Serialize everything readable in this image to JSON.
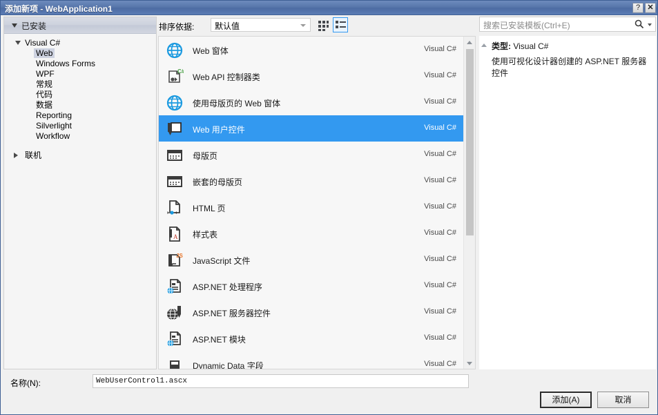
{
  "titlebar": {
    "title": "添加新项 - WebApplication1",
    "help_label": "?",
    "close_label": "✕"
  },
  "left_panel": {
    "installed_header": "已安装",
    "tree": [
      {
        "label": "Visual C#",
        "level": 1,
        "expanded": true,
        "selected": false
      },
      {
        "label": "Web",
        "level": 2,
        "expanded": false,
        "selected": true
      },
      {
        "label": "Windows Forms",
        "level": 2,
        "expanded": false,
        "selected": false
      },
      {
        "label": "WPF",
        "level": 2,
        "expanded": false,
        "selected": false
      },
      {
        "label": "常规",
        "level": 2,
        "expanded": false,
        "selected": false
      },
      {
        "label": "代码",
        "level": 2,
        "expanded": false,
        "selected": false
      },
      {
        "label": "数据",
        "level": 2,
        "expanded": false,
        "selected": false
      },
      {
        "label": "Reporting",
        "level": 2,
        "expanded": false,
        "selected": false
      },
      {
        "label": "Silverlight",
        "level": 2,
        "expanded": false,
        "selected": false
      },
      {
        "label": "Workflow",
        "level": 2,
        "expanded": false,
        "selected": false
      }
    ],
    "online_label": "联机"
  },
  "toolbar": {
    "sort_label": "排序依据:",
    "sort_value": "默认值",
    "view_tiles_name": "中等图标视图",
    "view_list_name": "详细信息视图"
  },
  "templates": [
    {
      "name": "Web 窗体",
      "lang": "Visual C#",
      "icon": "globe-icon",
      "selected": false
    },
    {
      "name": "Web API 控制器类",
      "lang": "Visual C#",
      "icon": "csharp-file-icon",
      "selected": false
    },
    {
      "name": "使用母版页的 Web 窗体",
      "lang": "Visual C#",
      "icon": "globe-icon",
      "selected": false
    },
    {
      "name": "Web 用户控件",
      "lang": "Visual C#",
      "icon": "user-control-icon",
      "selected": true
    },
    {
      "name": "母版页",
      "lang": "Visual C#",
      "icon": "master-page-icon",
      "selected": false
    },
    {
      "name": "嵌套的母版页",
      "lang": "Visual C#",
      "icon": "master-page-icon",
      "selected": false
    },
    {
      "name": "HTML 页",
      "lang": "Visual C#",
      "icon": "html-file-icon",
      "selected": false
    },
    {
      "name": "样式表",
      "lang": "Visual C#",
      "icon": "stylesheet-icon",
      "selected": false
    },
    {
      "name": "JavaScript 文件",
      "lang": "Visual C#",
      "icon": "javascript-file-icon",
      "selected": false
    },
    {
      "name": "ASP.NET 处理程序",
      "lang": "Visual C#",
      "icon": "aspnet-handler-icon",
      "selected": false
    },
    {
      "name": "ASP.NET 服务器控件",
      "lang": "Visual C#",
      "icon": "aspnet-server-control-icon",
      "selected": false
    },
    {
      "name": "ASP.NET 模块",
      "lang": "Visual C#",
      "icon": "aspnet-module-icon",
      "selected": false
    },
    {
      "name": "Dynamic Data 字段",
      "lang": "Visual C#",
      "icon": "dynamic-data-icon",
      "selected": false
    }
  ],
  "search": {
    "placeholder": "搜索已安装模板(Ctrl+E)"
  },
  "description": {
    "type_label": "类型:",
    "type_value": "Visual C#",
    "text": "使用可视化设计器创建的 ASP.NET 服务器控件"
  },
  "bottom": {
    "name_label": "名称(N):",
    "name_value": "WebUserControl1.ascx",
    "add_label": "添加(A)",
    "cancel_label": "取消"
  },
  "colors": {
    "titlebar": "#4d6ca3",
    "selection": "#3399f0",
    "tree_selection": "#cdd2e0",
    "panel_bg": "#f0f0f0"
  }
}
